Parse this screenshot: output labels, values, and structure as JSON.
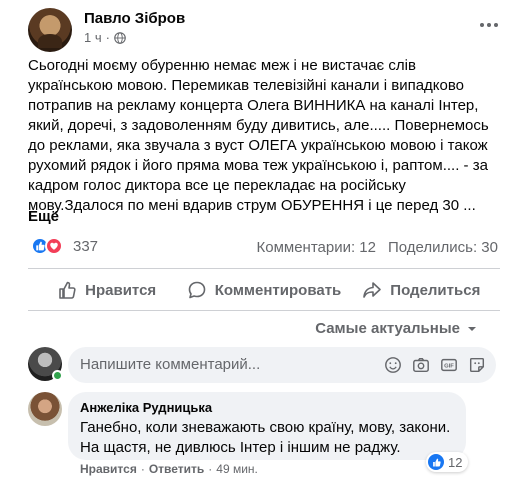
{
  "post": {
    "author": "Павло Зібров",
    "time": "1 ч",
    "text": "Сьогодні моєму обуренню немає меж і не вистачає слів\nукраїнською мовою. Перемикав телевізійні канали і випадково\nпотрапив на рекламу концерта Олега ВИННИКА на каналі Інтер,\nякий, доречі, з задоволенням буду дивитись, але..... Повернемось\nдо реклами, яка звучала з вуст ОЛЕГА українською мовою і також\nрухомий рядок і його пряма мова теж українською і, раптом.... - за\nкадром голос диктора все це перекладає  на російську\nмову.Здалося  по мені вдарив струм ОБУРЕННЯ і це перед 30 ...",
    "more_label": "Ещё"
  },
  "stats": {
    "reactions_count": "337",
    "comments": "Комментарии: 12",
    "shares": "Поделились: 30"
  },
  "actions": {
    "like": "Нравится",
    "comment": "Комментировать",
    "share": "Поделиться"
  },
  "sort": {
    "label": "Самые актуальные"
  },
  "composer": {
    "placeholder": "Напишите комментарий..."
  },
  "comment": {
    "author": "Анжеліка Рудницька",
    "text": "Ганебно, коли зневажають свою країну, мову, закони.\nНа щастя, не дивлюсь Інтер і іншим не раджу.",
    "reactions_count": "12",
    "like_label": "Нравится",
    "reply_label": "Ответить",
    "separator": "·",
    "time": "49 мин."
  },
  "colors": {
    "like_blue": "#1877f2",
    "love_red": "#f33e58",
    "secondary_text": "#65676b",
    "bubble_bg": "#f0f2f5"
  }
}
